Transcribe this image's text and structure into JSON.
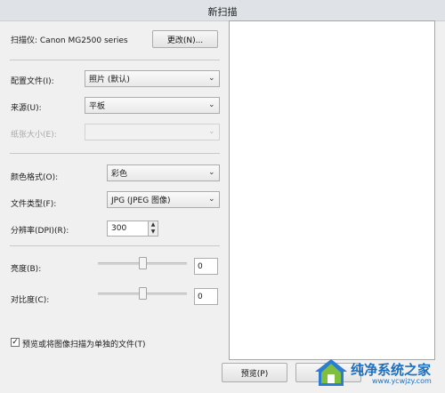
{
  "window": {
    "title": "新扫描"
  },
  "scanner": {
    "label": "扫描仪: Canon MG2500 series",
    "change_button": "更改(N)..."
  },
  "profile": {
    "label": "配置文件(I):",
    "value": "照片 (默认)"
  },
  "source": {
    "label": "来源(U):",
    "value": "平板"
  },
  "paper_size": {
    "label": "纸张大小(E):",
    "value": ""
  },
  "color_format": {
    "label": "颜色格式(O):",
    "value": "彩色"
  },
  "file_type": {
    "label": "文件类型(F):",
    "value": "JPG (JPEG 图像)"
  },
  "resolution": {
    "label": "分辨率(DPI)(R):",
    "value": "300"
  },
  "brightness": {
    "label": "亮度(B):",
    "value": "0",
    "level": 0.5
  },
  "contrast": {
    "label": "对比度(C):",
    "value": "0",
    "level": 0.5
  },
  "preview_checkbox": {
    "label": "预览或将图像扫描为单独的文件(T)",
    "checked": true
  },
  "buttons": {
    "preview": "预览(P)"
  },
  "watermark": {
    "text": "纯净系统之家",
    "url": "www.ycwjzy.com"
  },
  "icons": {
    "dropdown": "chevron-down-icon",
    "spin_up": "spin-up-icon",
    "spin_down": "spin-down-icon",
    "check": "checkmark-icon"
  }
}
